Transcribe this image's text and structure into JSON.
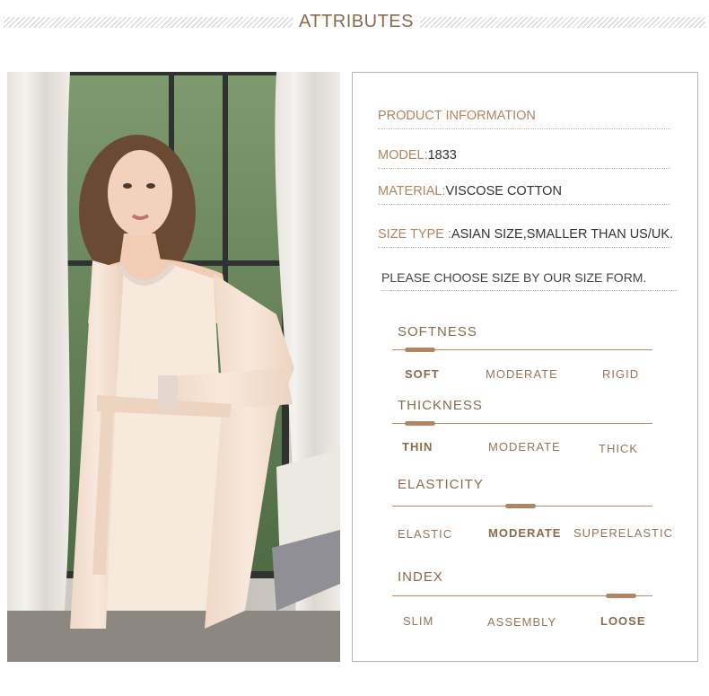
{
  "header": {
    "title": "ATTRIBUTES"
  },
  "product_info": {
    "heading": "PRODUCT INFORMATION",
    "model_label": "MODEL:",
    "model_value": "1833",
    "material_label": "MATERIAL:",
    "material_value": "VISCOSE COTTON",
    "size_type_label": "SIZE TYPE :",
    "size_type_value": "ASIAN SIZE,SMALLER THAN US/UK.",
    "note": "PLEASE CHOOSE SIZE BY OUR SIZE FORM."
  },
  "attributes": [
    {
      "title": "SOFTNESS",
      "options": [
        "SOFT",
        "MODERATE",
        "RIGID"
      ],
      "selected": "SOFT",
      "level": 0
    },
    {
      "title": "THICKNESS",
      "options": [
        "THIN",
        "MODERATE",
        "THICK"
      ],
      "selected": "THIN",
      "level": 0
    },
    {
      "title": "ELASTICITY",
      "options": [
        "ELASTIC",
        "MODERATE",
        "SUPERELASTIC"
      ],
      "selected": "MODERATE",
      "level": 0.5
    },
    {
      "title": "INDEX",
      "options": [
        "SLIM",
        "ASSEMBLY",
        "LOOSE"
      ],
      "selected": "LOOSE",
      "level": 1
    }
  ],
  "colors": {
    "accent": "#b08560",
    "header_text": "#8b6a4c",
    "garment": "#f6e4d6"
  }
}
